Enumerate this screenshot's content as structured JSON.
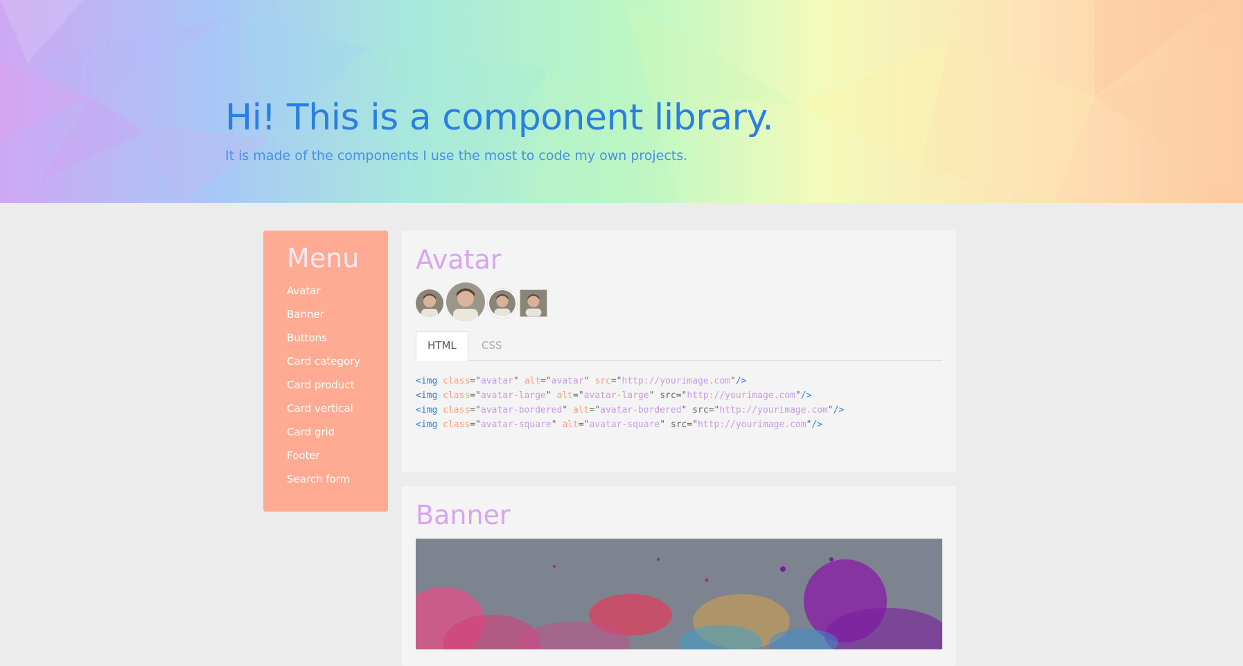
{
  "hero": {
    "title": "Hi! This is a component library.",
    "subtitle": "It is made of the components I use the most to code my own projects."
  },
  "menu": {
    "title": "Menu",
    "items": [
      "Avatar",
      "Banner",
      "Buttons",
      "Card category",
      "Card product",
      "Card vertical",
      "Card grid",
      "Footer",
      "Search form"
    ]
  },
  "avatar_section": {
    "title": "Avatar",
    "tabs": [
      "HTML",
      "CSS"
    ],
    "active_tab": "HTML",
    "code_lines": [
      [
        [
          "<img ",
          "tag"
        ],
        [
          "class",
          "attr"
        ],
        [
          "=\"",
          "plain"
        ],
        [
          "avatar",
          "val"
        ],
        [
          "\" ",
          "plain"
        ],
        [
          "alt",
          "attr"
        ],
        [
          "=\"",
          "plain"
        ],
        [
          "avatar",
          "val"
        ],
        [
          "\" ",
          "plain"
        ],
        [
          "src",
          "attr"
        ],
        [
          "=\"",
          "plain"
        ],
        [
          "http://yourimage.com",
          "val"
        ],
        [
          "\"",
          "plain"
        ],
        [
          "/>",
          "tag"
        ]
      ],
      [
        [
          "<img ",
          "tag"
        ],
        [
          "class",
          "attr"
        ],
        [
          "=\"",
          "plain"
        ],
        [
          "avatar-large",
          "val"
        ],
        [
          "\" ",
          "plain"
        ],
        [
          "alt",
          "attr"
        ],
        [
          "=\"",
          "plain"
        ],
        [
          "avatar-large",
          "val"
        ],
        [
          "\" src=\"",
          "plain"
        ],
        [
          "http://yourimage.com",
          "val"
        ],
        [
          "\"",
          "plain"
        ],
        [
          "/>",
          "tag"
        ]
      ],
      [
        [
          "<img ",
          "tag"
        ],
        [
          "class",
          "attr"
        ],
        [
          "=\"",
          "plain"
        ],
        [
          "avatar-bordered",
          "val"
        ],
        [
          "\" ",
          "plain"
        ],
        [
          "alt",
          "attr"
        ],
        [
          "=\"",
          "plain"
        ],
        [
          "avatar-bordered",
          "val"
        ],
        [
          "\" src=\"",
          "plain"
        ],
        [
          "http://yourimage.com",
          "val"
        ],
        [
          "\"",
          "plain"
        ],
        [
          "/>",
          "tag"
        ]
      ],
      [
        [
          "<img ",
          "tag"
        ],
        [
          "class",
          "attr"
        ],
        [
          "=\"",
          "plain"
        ],
        [
          "avatar-square",
          "val"
        ],
        [
          "\" ",
          "plain"
        ],
        [
          "alt",
          "attr"
        ],
        [
          "=\"",
          "plain"
        ],
        [
          "avatar-square",
          "val"
        ],
        [
          "\" src=\"",
          "plain"
        ],
        [
          "http://yourimage.com",
          "val"
        ],
        [
          "\"",
          "plain"
        ],
        [
          "/>",
          "tag"
        ]
      ]
    ]
  },
  "banner_section": {
    "title": "Banner"
  },
  "colors": {
    "accent_blue": "#2a7fe0",
    "menu_bg": "#ffab94",
    "section_title": "#d6a5ef",
    "page_bg": "#ececec"
  }
}
